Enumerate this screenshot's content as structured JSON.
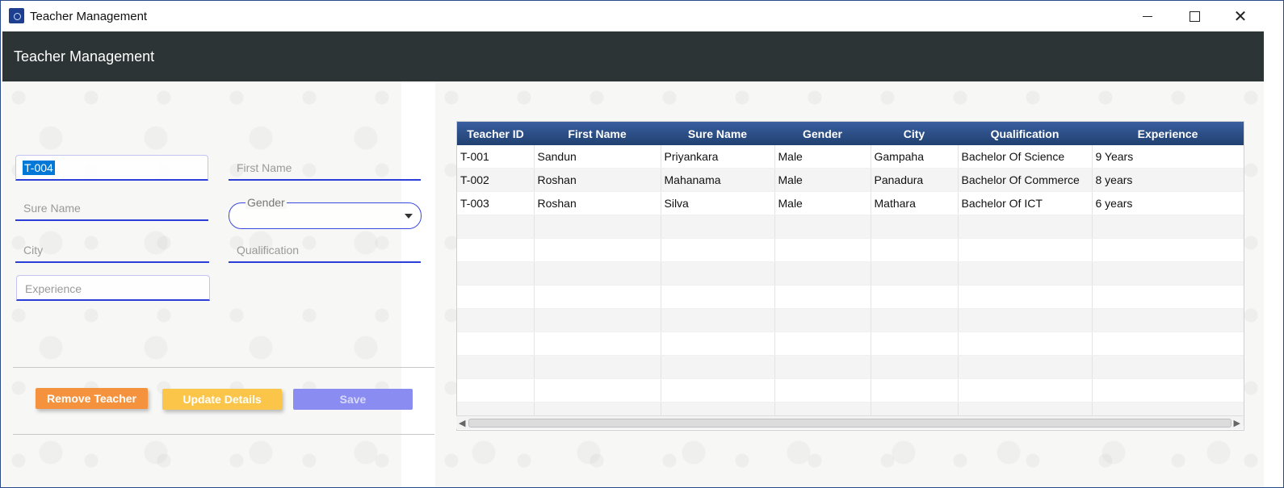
{
  "window": {
    "title": "Teacher Management"
  },
  "header": {
    "title": "Teacher Management"
  },
  "form": {
    "teacher_id": "T-004",
    "first_name_placeholder": "First Name",
    "sure_name_placeholder": "Sure Name",
    "gender_label": "Gender",
    "city_placeholder": "City",
    "qualification_placeholder": "Qualification",
    "experience_placeholder": "Experience"
  },
  "buttons": {
    "remove": "Remove Teacher",
    "update": "Update Details",
    "save": "Save"
  },
  "colors": {
    "header_bg": "#2d3436",
    "remove_btn": "#f5923e",
    "update_btn": "#fbc54a",
    "save_btn": "#8a8cf2",
    "table_header": "#2c4a80",
    "field_underline": "#2b3fd8"
  },
  "table": {
    "columns": [
      "Teacher ID",
      "First Name",
      "Sure Name",
      "Gender",
      "City",
      "Qualification",
      "Experience"
    ],
    "rows": [
      [
        "T-001",
        "Sandun",
        "Priyankara",
        "Male",
        "Gampaha",
        "Bachelor Of Science",
        "9 Years"
      ],
      [
        "T-002",
        "Roshan",
        "Mahanama",
        "Male",
        "Panadura",
        "Bachelor Of Commerce",
        "8 years"
      ],
      [
        "T-003",
        "Roshan",
        "Silva",
        "Male",
        "Mathara",
        "Bachelor Of ICT",
        "6 years"
      ]
    ]
  }
}
